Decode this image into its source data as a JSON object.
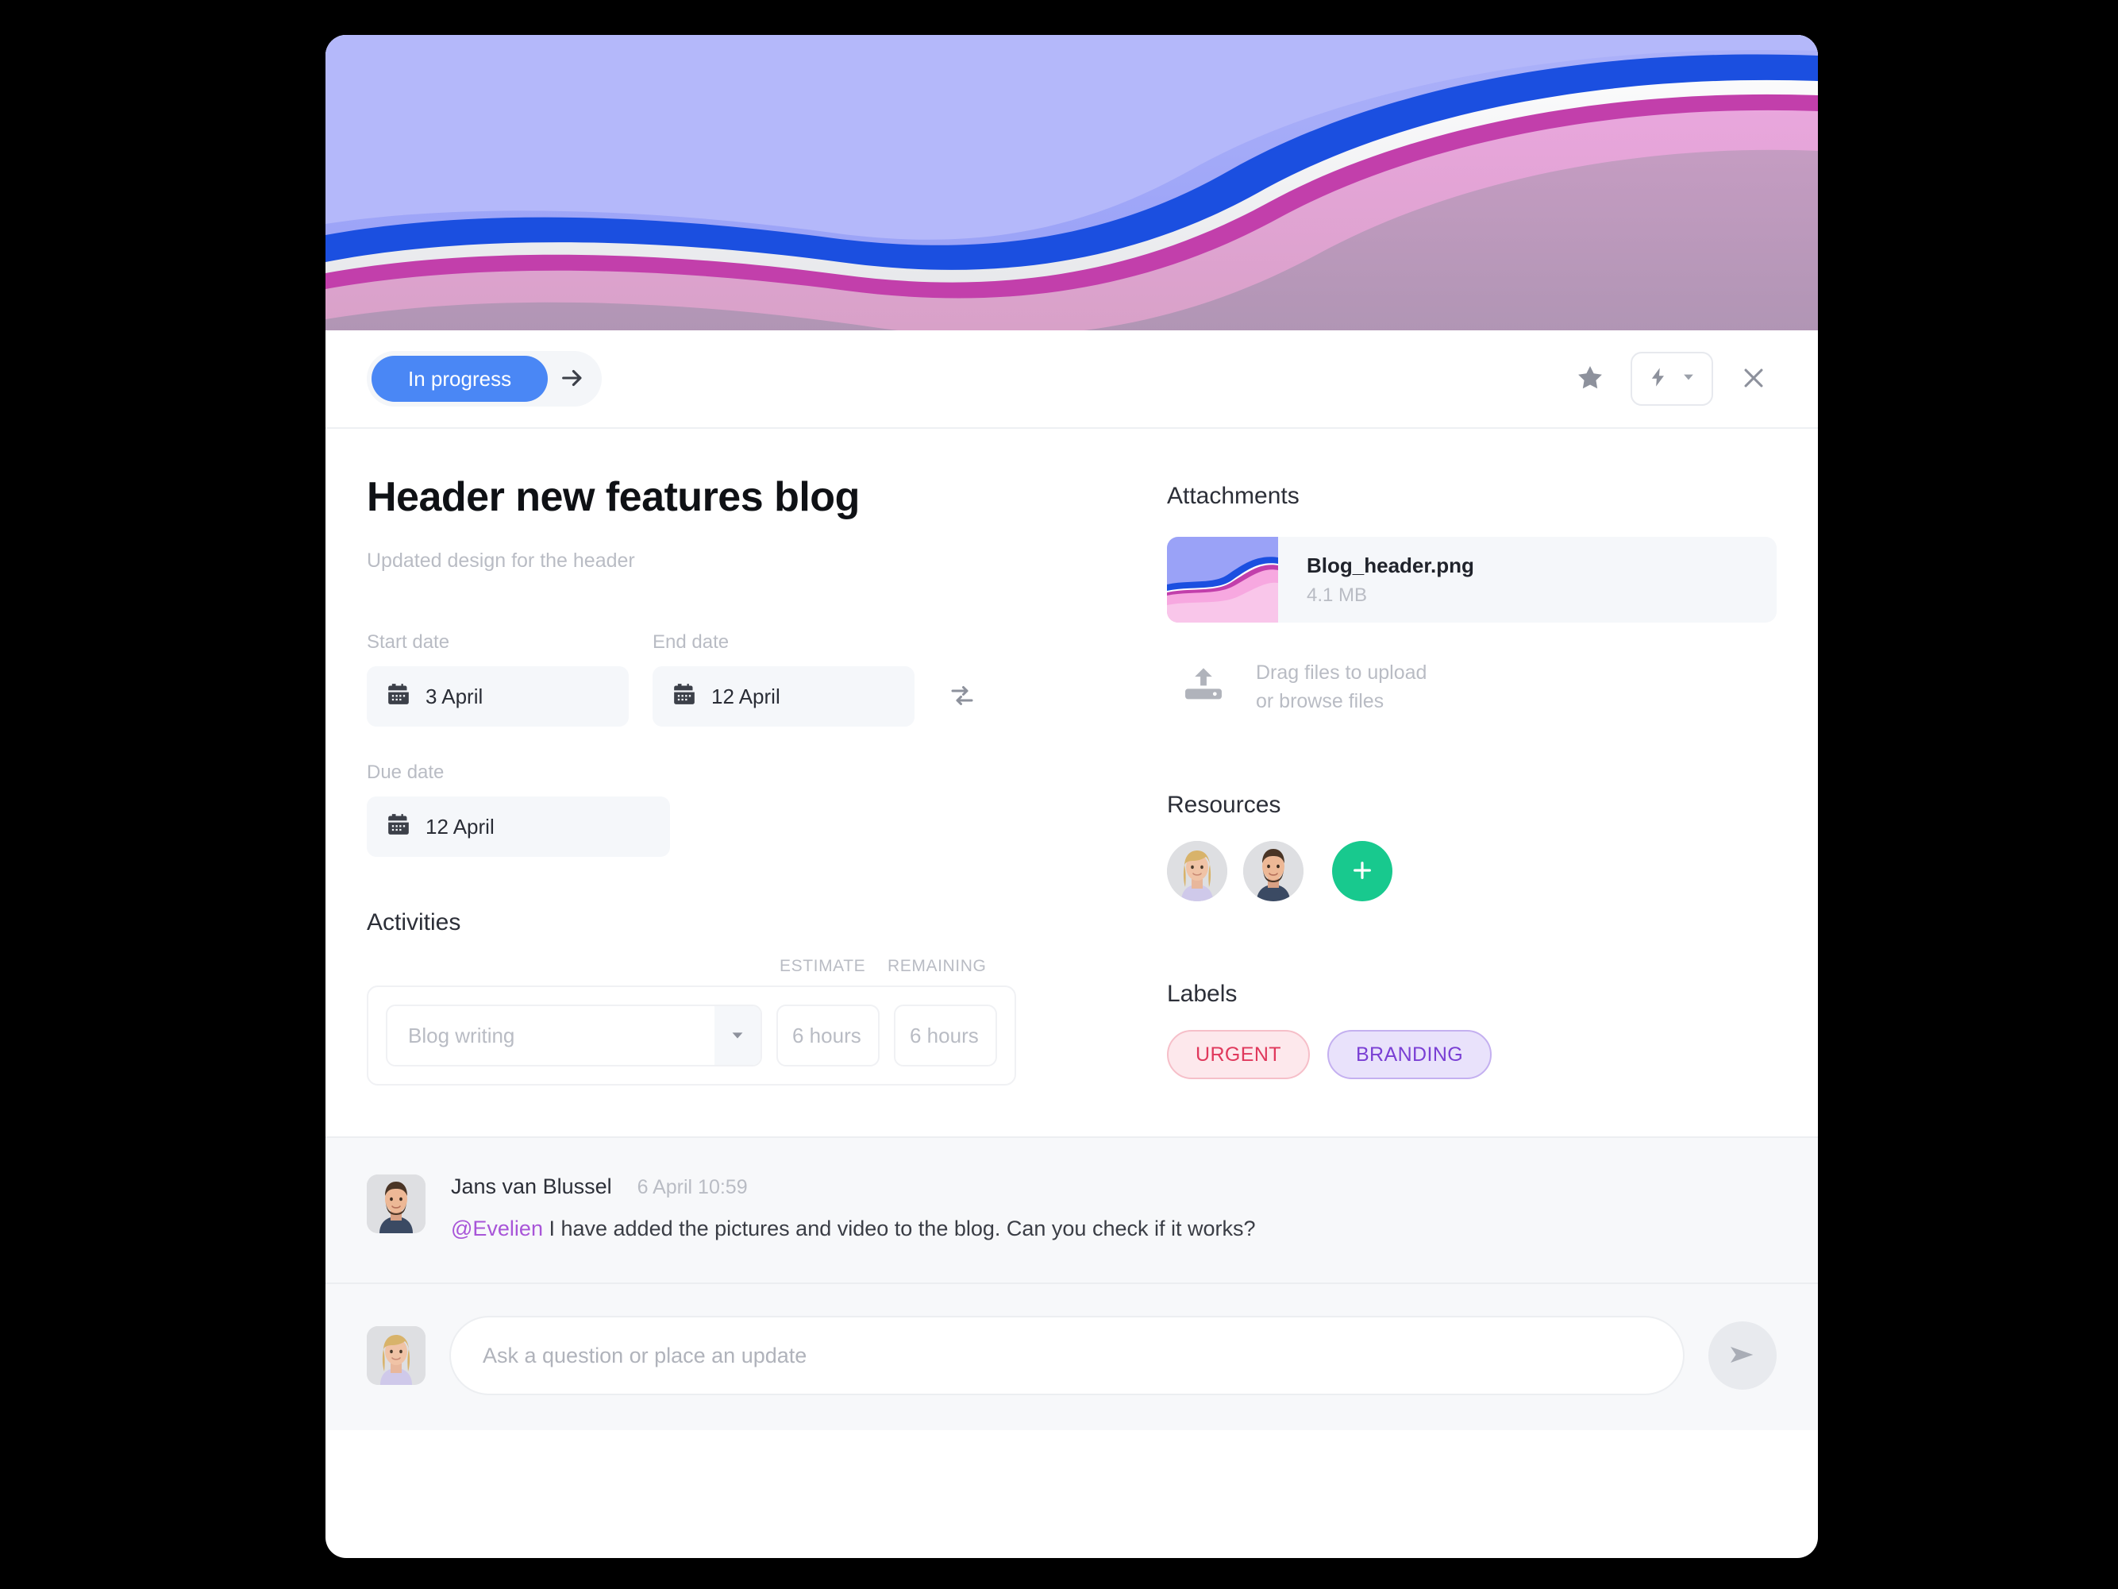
{
  "toolbar": {
    "status_label": "In progress",
    "next_status_icon": "arrow-right-icon",
    "favorite_icon": "star-icon",
    "automation_icon": "lightning-bolt-icon",
    "dropdown_icon": "chevron-down-icon",
    "close_icon": "close-icon"
  },
  "task": {
    "title": "Header new features blog",
    "subtitle": "Updated design for the header"
  },
  "dates": {
    "start_label": "Start date",
    "start_value": "3 April",
    "end_label": "End date",
    "end_value": "12 April",
    "due_label": "Due date",
    "due_value": "12 April",
    "calendar_icon": "calendar-icon",
    "swap_icon": "swap-arrows-icon"
  },
  "activities": {
    "title": "Activities",
    "col_estimate": "ESTIMATE",
    "col_remaining": "REMAINING",
    "rows": [
      {
        "name": "Blog writing",
        "estimate": "6 hours",
        "remaining": "6 hours"
      }
    ]
  },
  "attachments": {
    "title": "Attachments",
    "files": [
      {
        "name": "Blog_header.png",
        "size": "4.1 MB"
      }
    ],
    "upload_icon": "upload-icon",
    "drag_text": "Drag files to upload",
    "browse_text": "or browse files"
  },
  "resources": {
    "title": "Resources",
    "add_icon": "plus-icon",
    "people": [
      {
        "name": "avatar-woman-blonde"
      },
      {
        "name": "avatar-man-beard"
      }
    ]
  },
  "labels": {
    "title": "Labels",
    "chips": [
      {
        "text": "URGENT",
        "color": "#e0385c"
      },
      {
        "text": "BRANDING",
        "color": "#7a3fd4"
      }
    ]
  },
  "comments": [
    {
      "author": "Jans van Blussel",
      "time": "6 April 10:59",
      "mention": "@Evelien",
      "body": " I have added the pictures and video to the blog. Can you check if it works?"
    }
  ],
  "composer": {
    "placeholder": "Ask a question or place an update",
    "send_icon": "send-icon"
  },
  "colors": {
    "accent_blue": "#4a87f5",
    "green": "#18c98e",
    "mention_purple": "#a855d8",
    "panel_gray": "#f5f7fa"
  }
}
